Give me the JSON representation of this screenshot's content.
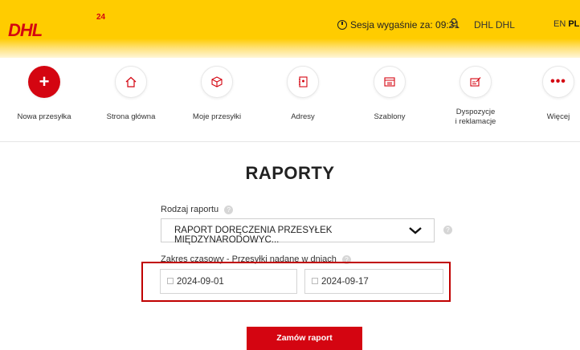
{
  "header": {
    "logo_text": "DHL",
    "logo_badge": "24",
    "session_text": "Sesja wygaśnie za: 09:31",
    "user_name": "DHL DHL",
    "lang_en": "EN",
    "lang_pl": "PL"
  },
  "nav": {
    "items": [
      {
        "label": "Nowa przesyłka",
        "icon": "plus-icon"
      },
      {
        "label": "Strona główna",
        "icon": "home-icon"
      },
      {
        "label": "Moje przesyłki",
        "icon": "box-icon"
      },
      {
        "label": "Adresy",
        "icon": "address-book-icon"
      },
      {
        "label": "Szablony",
        "icon": "template-icon"
      },
      {
        "label_line1": "Dyspozycje",
        "label_line2": "i reklamacje",
        "icon": "complaint-icon"
      },
      {
        "label": "Więcej",
        "icon": "more-icon"
      }
    ]
  },
  "main": {
    "title": "RAPORTY",
    "report_type_label": "Rodzaj raportu",
    "report_type_value": "RAPORT DORĘCZENIA PRZESYŁEK MIĘDZYNARODOWYC...",
    "date_range_label": "Zakres czasowy - Przesyłki nadane w dniach",
    "date_from": "2024-09-01",
    "date_to": "2024-09-17",
    "submit_label": "Zamów raport"
  },
  "colors": {
    "brand_yellow": "#ffcc00",
    "brand_red": "#d40511",
    "highlight_box": "#c00000"
  }
}
